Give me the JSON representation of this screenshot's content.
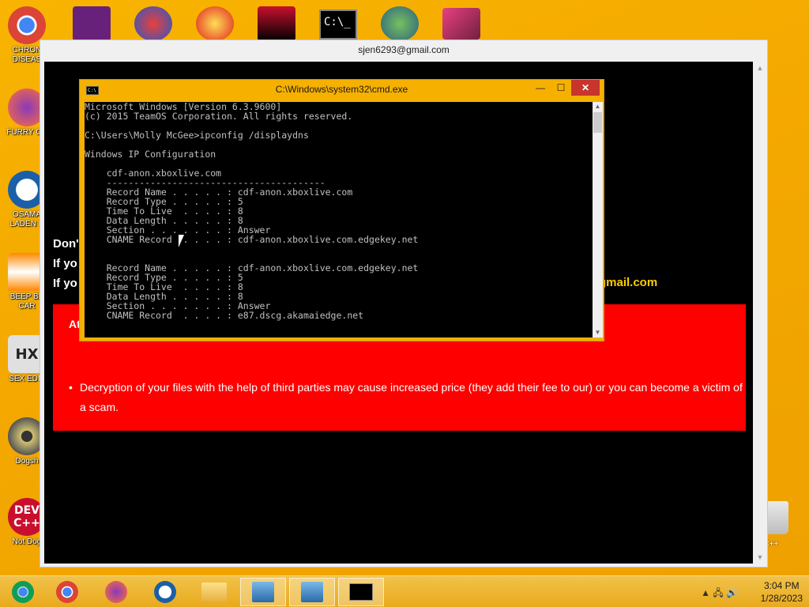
{
  "desktop": {
    "icons": [
      {
        "label": "CHRON DISEAS",
        "name": "chrome"
      },
      {
        "label": "FURRY CU",
        "name": "firefox"
      },
      {
        "label": "OSAMA LADEN E",
        "name": "obama"
      },
      {
        "label": "BEEP BE CAR",
        "name": "vlc"
      },
      {
        "label": "SEX EDIT",
        "name": "hex"
      },
      {
        "label": "Dogsh",
        "name": "dvd"
      },
      {
        "label": "Not Dog",
        "name": "devcpp"
      }
    ],
    "right_labels": [
      "n C++"
    ]
  },
  "main_window": {
    "title": "sjen6293@gmail.com",
    "lines": [
      "Don'",
      "If yo",
      "If yo"
    ],
    "email_fragment": "gmail.com",
    "red_heading": "At",
    "bullet_text": "Decryption of your files with the help of third parties may cause increased price (they add their fee to our) or you can become a victim of a scam."
  },
  "cmd": {
    "title": "C:\\Windows\\system32\\cmd.exe",
    "buttons": {
      "min": "—",
      "max": "☐",
      "close": "✕"
    },
    "lines": [
      "Microsoft Windows [Version 6.3.9600]",
      "(c) 2015 TeamOS Corporation. All rights reserved.",
      "",
      "C:\\Users\\Molly McGee>ipconfig /displaydns",
      "",
      "Windows IP Configuration",
      "",
      "    cdf-anon.xboxlive.com",
      "    ----------------------------------------",
      "    Record Name . . . . . : cdf-anon.xboxlive.com",
      "    Record Type . . . . . : 5",
      "    Time To Live  . . . . : 8",
      "    Data Length . . . . . : 8",
      "    Section . . . . . . . : Answer",
      "    CNAME Record  . . . . : cdf-anon.xboxlive.com.edgekey.net",
      "",
      "",
      "    Record Name . . . . . : cdf-anon.xboxlive.com.edgekey.net",
      "    Record Type . . . . . : 5",
      "    Time To Live  . . . . : 8",
      "    Data Length . . . . . : 8",
      "    Section . . . . . . . : Answer",
      "    CNAME Record  . . . . : e87.dscg.akamaiedge.net"
    ]
  },
  "taskbar": {
    "time": "3:04 PM",
    "date": "1/28/2023"
  }
}
